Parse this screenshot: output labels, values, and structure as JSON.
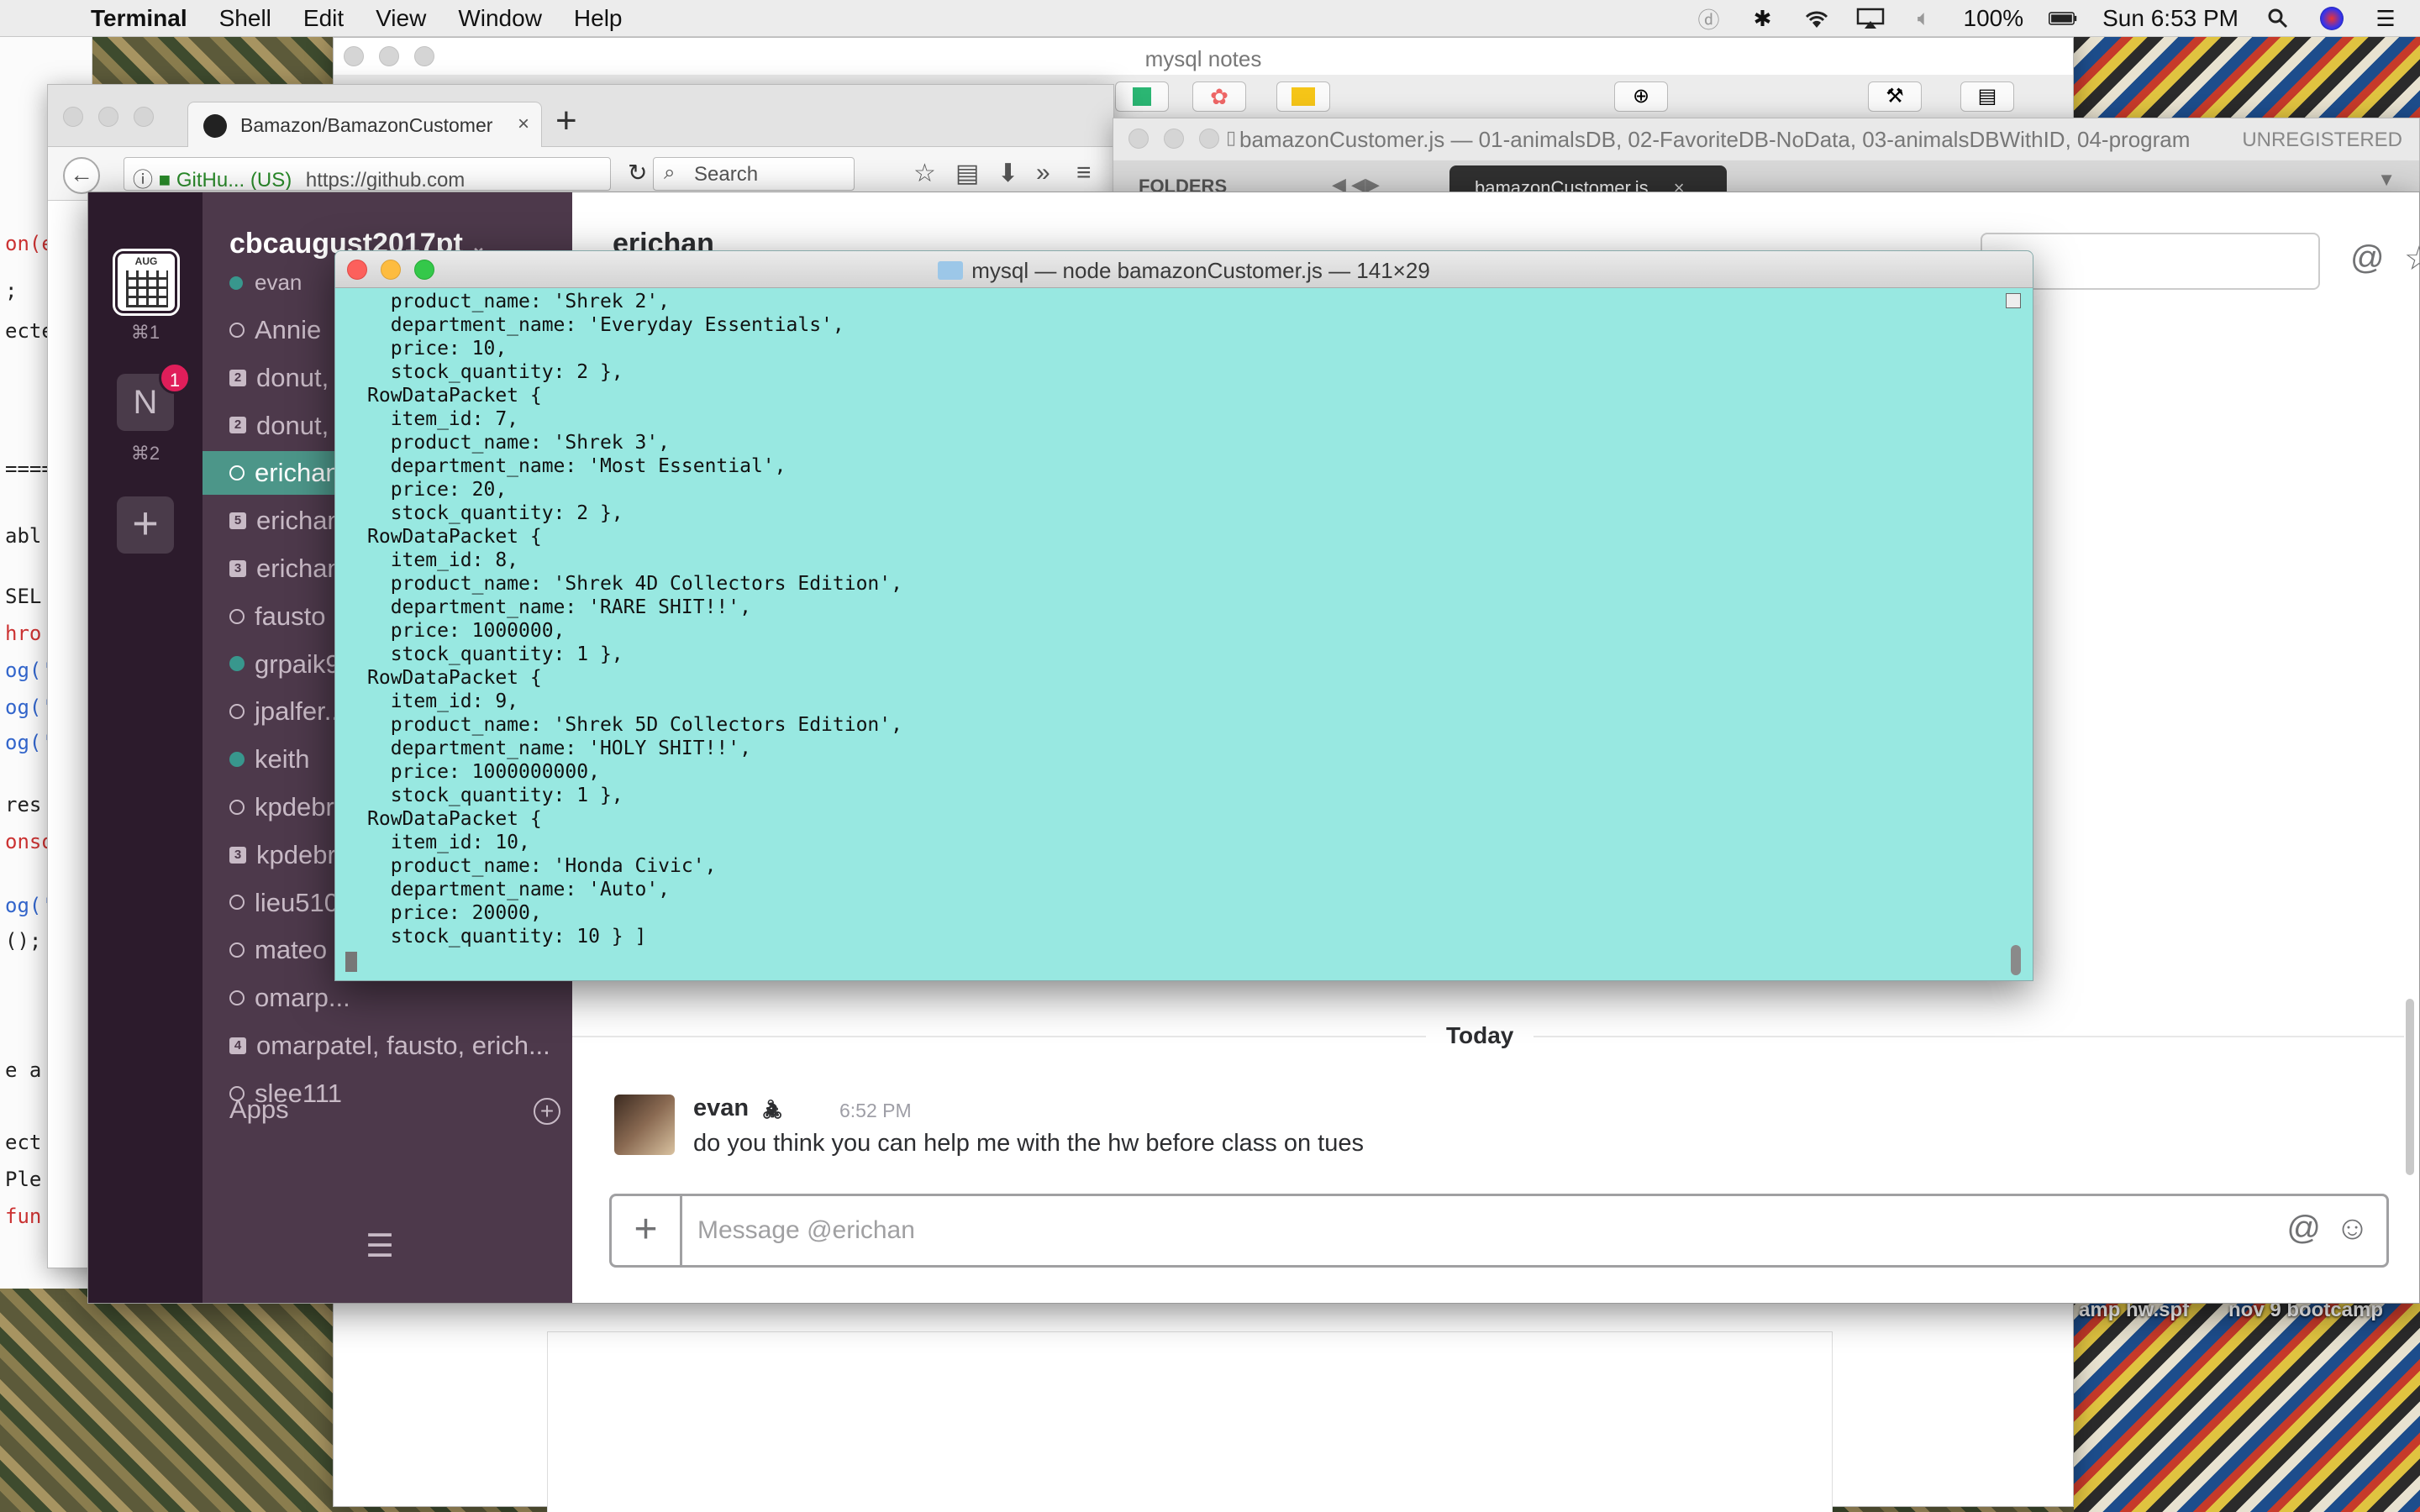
{
  "menubar": {
    "app": "Terminal",
    "items": [
      "Shell",
      "Edit",
      "View",
      "Window",
      "Help"
    ],
    "battery": "100%",
    "clock": "Sun 6:53 PM"
  },
  "desktop": {
    "icon_label_1": "amp hw.spf",
    "icon_label_2": "nov 9 bootcamp"
  },
  "notes_window": {
    "title": "mysql notes"
  },
  "browser": {
    "tab_title": "Bamazon/BamazonCustomer",
    "url_prefix": "GitHu... (US)",
    "url": "https://github.com",
    "search_placeholder": "Search"
  },
  "sublime": {
    "title": "bamazonCustomer.js — 01-animalsDB, 02-FavoriteDB-NoData, 03-animalsDBWithID, 04-program",
    "unregistered": "UNREGISTERED",
    "folders": "FOLDERS",
    "tab": "bamazonCustomer.js"
  },
  "slack": {
    "workspace": "cbcaugust2017pt",
    "me": "evan",
    "rail": {
      "cal_month": "AUG",
      "key1": "⌘1",
      "team2": "N",
      "team2_badge": "1",
      "key2": "⌘2"
    },
    "dms": [
      {
        "name": "Annie",
        "type": "away"
      },
      {
        "name": "donut, ...",
        "type": "group",
        "count": "2"
      },
      {
        "name": "donut, ...",
        "type": "group",
        "count": "2"
      },
      {
        "name": "erichan",
        "type": "away",
        "active": true
      },
      {
        "name": "erichan, ...",
        "type": "group",
        "count": "5"
      },
      {
        "name": "erichan, ...",
        "type": "group",
        "count": "3"
      },
      {
        "name": "fausto",
        "type": "away"
      },
      {
        "name": "grpaik9",
        "type": "online"
      },
      {
        "name": "jpalfer...",
        "type": "away"
      },
      {
        "name": "keith",
        "type": "online"
      },
      {
        "name": "kpdebr...",
        "type": "away"
      },
      {
        "name": "kpdebr...",
        "type": "group",
        "count": "3"
      },
      {
        "name": "lieu510",
        "type": "away"
      },
      {
        "name": "mateo",
        "type": "away"
      },
      {
        "name": "omarp...",
        "type": "away"
      },
      {
        "name": "omarpatel, fausto, erich...",
        "type": "group",
        "count": "4"
      },
      {
        "name": "slee111",
        "type": "away"
      }
    ],
    "apps_label": "Apps",
    "channel_title": "erichan",
    "day_divider": "Today",
    "message": {
      "author": "evan",
      "time": "6:52 PM",
      "text": "do you think you can help me with the hw before class on tues"
    },
    "composer_placeholder": "Message @erichan"
  },
  "terminal": {
    "title": "mysql — node bamazonCustomer.js — 141×29",
    "lines": [
      "product_name: 'Shrek 2',",
      "department_name: 'Everyday Essentials',",
      "price: 10,",
      "stock_quantity: 2 },",
      "RowDataPacket {",
      "item_id: 7,",
      "product_name: 'Shrek 3',",
      "department_name: 'Most Essential',",
      "price: 20,",
      "stock_quantity: 2 },",
      "RowDataPacket {",
      "item_id: 8,",
      "product_name: 'Shrek 4D Collectors Edition',",
      "department_name: 'RARE SHIT!!',",
      "price: 1000000,",
      "stock_quantity: 1 },",
      "RowDataPacket {",
      "item_id: 9,",
      "product_name: 'Shrek 5D Collectors Edition',",
      "department_name: 'HOLY SHIT!!',",
      "price: 1000000000,",
      "stock_quantity: 1 },",
      "RowDataPacket {",
      "item_id: 10,",
      "product_name: 'Honda Civic',",
      "department_name: 'Auto',",
      "price: 20000,",
      "stock_quantity: 10 } ]"
    ]
  },
  "colors": {
    "terminal_bg": "#98e8e1",
    "slack_sidebar": "#4d394b",
    "slack_active": "#4c9689",
    "online": "#38978d"
  }
}
